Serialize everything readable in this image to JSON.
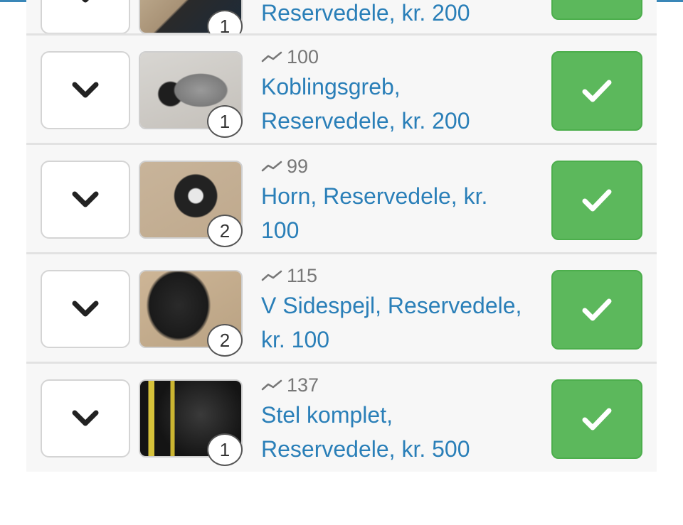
{
  "colors": {
    "link": "#2a7fb8",
    "success": "#5cb85c",
    "top_border": "#3a87b8"
  },
  "icons": {
    "expand": "chevron-down-icon",
    "select": "checkmark-icon",
    "views": "trend-icon"
  },
  "items": [
    {
      "views": "",
      "title": "Reservedele, kr. 200",
      "image_count": "1"
    },
    {
      "views": "100",
      "title": "Koblingsgreb, Reservedele, kr. 200",
      "image_count": "1"
    },
    {
      "views": "99",
      "title": "Horn, Reservedele, kr. 100",
      "image_count": "2"
    },
    {
      "views": "115",
      "title": "V Sidespejl, Reservedele, kr. 100",
      "image_count": "2"
    },
    {
      "views": "137",
      "title": "Stel komplet, Reservedele, kr. 500",
      "image_count": "1"
    }
  ]
}
